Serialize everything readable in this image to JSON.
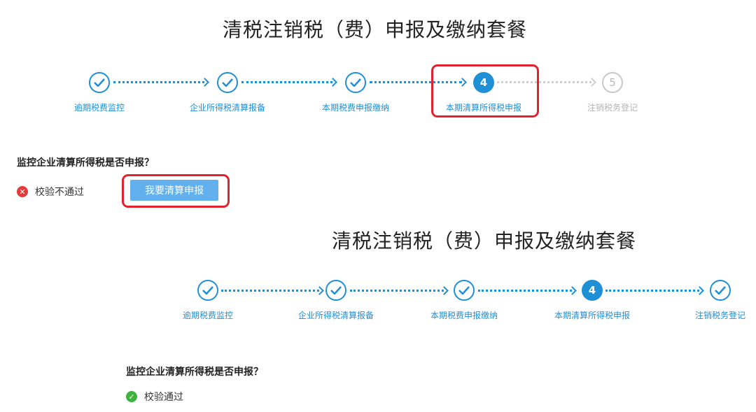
{
  "colors": {
    "accent": "#1f8fd6",
    "highlight_border": "#e0232e",
    "button_bg": "#62b1ee",
    "fail": "#e53a3a",
    "pass": "#3db33d",
    "pending": "#c8c8c8"
  },
  "top_panel": {
    "title": "清税注销税（费）申报及缴纳套餐",
    "steps": [
      {
        "label": "逾期税费监控",
        "state": "done",
        "number": ""
      },
      {
        "label": "企业所得税清算报备",
        "state": "done",
        "number": ""
      },
      {
        "label": "本期税费申报缴纳",
        "state": "done",
        "number": ""
      },
      {
        "label": "本期清算所得税申报",
        "state": "active",
        "number": "4"
      },
      {
        "label": "注销税务登记",
        "state": "pending",
        "number": "5"
      }
    ],
    "question": "监控企业清算所得税是否申报？",
    "status_icon": "error-x-icon",
    "status_text": "校验不通过",
    "button_label": "我要清算申报"
  },
  "bottom_panel": {
    "title": "清税注销税（费）申报及缴纳套餐",
    "steps": [
      {
        "label": "逾期税费监控",
        "state": "done",
        "number": ""
      },
      {
        "label": "企业所得税清算报备",
        "state": "done",
        "number": ""
      },
      {
        "label": "本期税费申报缴纳",
        "state": "done",
        "number": ""
      },
      {
        "label": "本期清算所得税申报",
        "state": "active",
        "number": "4"
      },
      {
        "label": "注销税务登记",
        "state": "done",
        "number": ""
      }
    ],
    "question": "监控企业清算所得税是否申报？",
    "status_icon": "check-icon",
    "status_text": "校验通过"
  }
}
